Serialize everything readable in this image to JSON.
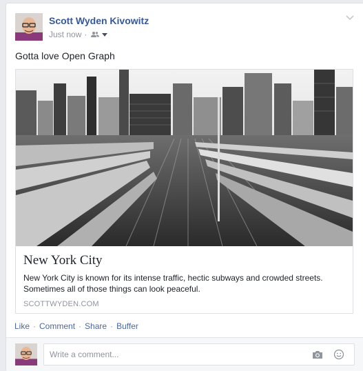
{
  "post": {
    "author": "Scott Wyden Kivowitz",
    "timestamp": "Just now",
    "separator": "·",
    "audience_icon": "friends-icon",
    "status_text": "Gotta love Open Graph"
  },
  "link_preview": {
    "title": "New York City",
    "description": "New York City is known for its intense traffic, hectic subways and crowded streets. Sometimes all of those things can look peaceful.",
    "domain": "SCOTTWYDEN.COM"
  },
  "actions": {
    "like": "Like",
    "comment": "Comment",
    "share": "Share",
    "buffer": "Buffer",
    "separator": "·"
  },
  "comment_box": {
    "placeholder": "Write a comment...",
    "camera_icon": "camera-icon",
    "emoji_icon": "smiley-icon"
  },
  "colors": {
    "link_blue": "#365899",
    "action_blue": "#4b67a1",
    "muted": "#90949c"
  }
}
